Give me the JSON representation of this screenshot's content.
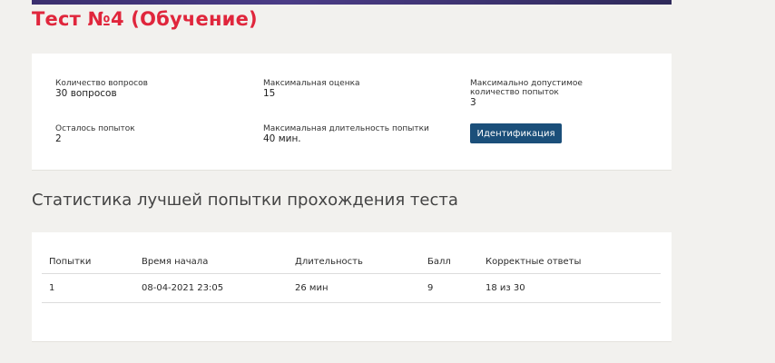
{
  "page": {
    "title": "Тест №4 (Обучение)"
  },
  "info": {
    "questions_label": "Количество вопросов",
    "questions_value": "30 вопросов",
    "max_score_label": "Максимальная оценка",
    "max_score_value": "15",
    "max_attempts_label": "Максимально допустимое количество попыток",
    "max_attempts_value": "3",
    "remaining_label": "Осталось попыток",
    "remaining_value": "2",
    "max_duration_label": "Максимальная длительность попытки",
    "max_duration_value": "40 мин.",
    "identify_button": "Идентификация"
  },
  "stats": {
    "heading": "Статистика лучшей попытки прохождения теста",
    "columns": [
      "Попытки",
      "Время начала",
      "Длительность",
      "Балл",
      "Корректные ответы"
    ],
    "rows": [
      [
        "1",
        "08-04-2021 23:05",
        "26 мин",
        "9",
        "18 из 30"
      ]
    ]
  },
  "colors": {
    "title": "#e0263c",
    "button": "#1b4f7a",
    "background": "#f2f1ee"
  }
}
